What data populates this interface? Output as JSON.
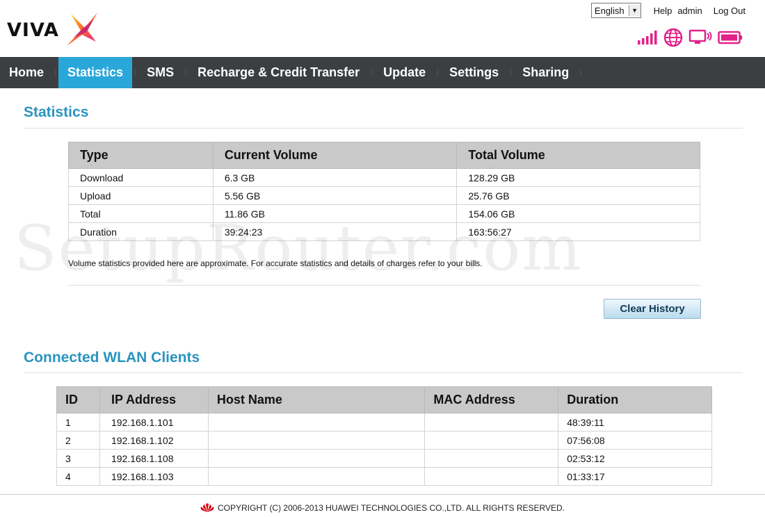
{
  "header": {
    "logo_text": "VIVA",
    "language": "English",
    "help_label": "Help",
    "user_label": "admin",
    "logout_label": "Log Out"
  },
  "nav": {
    "items": [
      {
        "label": "Home",
        "active": false
      },
      {
        "label": "Statistics",
        "active": true
      },
      {
        "label": "SMS",
        "active": false
      },
      {
        "label": "Recharge & Credit Transfer",
        "active": false
      },
      {
        "label": "Update",
        "active": false
      },
      {
        "label": "Settings",
        "active": false
      },
      {
        "label": "Sharing",
        "active": false
      }
    ]
  },
  "colors": {
    "accent": "#2aa7d9",
    "nav_bg": "#3b3f42",
    "title": "#2a94bf",
    "status_icons": "#e0218a"
  },
  "status_icons": [
    "signal-strength-icon",
    "internet-globe-icon",
    "wifi-monitor-icon",
    "battery-icon"
  ],
  "statistics": {
    "title": "Statistics",
    "headers": [
      "Type",
      "Current Volume",
      "Total Volume"
    ],
    "rows": [
      [
        "Download",
        "6.3 GB",
        "128.29 GB"
      ],
      [
        "Upload",
        "5.56 GB",
        "25.76 GB"
      ],
      [
        "Total",
        "11.86 GB",
        "154.06 GB"
      ],
      [
        "Duration",
        "39:24:23",
        "163:56:27"
      ]
    ],
    "note": "Volume statistics provided here are approximate. For accurate statistics and details of charges refer to your bills.",
    "clear_button": "Clear History"
  },
  "wlan": {
    "title": "Connected WLAN Clients",
    "headers": [
      "ID",
      "IP Address",
      "Host Name",
      "MAC Address",
      "Duration"
    ],
    "rows": [
      [
        "1",
        "192.168.1.101",
        "",
        "",
        "48:39:11"
      ],
      [
        "2",
        "192.168.1.102",
        "",
        "",
        "07:56:08"
      ],
      [
        "3",
        "192.168.1.108",
        "",
        "",
        "02:53:12"
      ],
      [
        "4",
        "192.168.1.103",
        "",
        "",
        "01:33:17"
      ]
    ]
  },
  "watermark": "SetupRouter.com",
  "footer": {
    "copyright": "COPYRIGHT (C) 2006-2013 HUAWEI TECHNOLOGIES CO.,LTD. ALL RIGHTS RESERVED."
  }
}
